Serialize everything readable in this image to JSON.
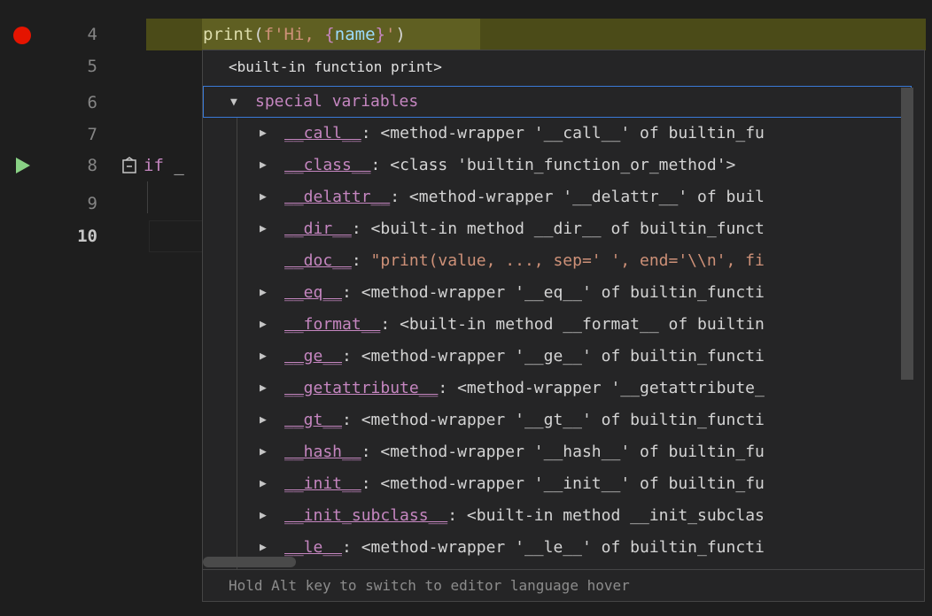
{
  "editor": {
    "lines": [
      {
        "num": "4",
        "breakpoint": true
      },
      {
        "num": "5"
      },
      {
        "num": "6"
      },
      {
        "num": "7"
      },
      {
        "num": "8",
        "debug_arrow": true
      },
      {
        "num": "9"
      },
      {
        "num": "10",
        "active": true
      }
    ],
    "line4": {
      "fn": "print",
      "paren_open": "(",
      "prefix": "f'Hi, ",
      "brace_open": "{",
      "var": "name",
      "brace_close": "}",
      "suffix": "'",
      "paren_close": ")"
    },
    "line8": {
      "keyword": "if",
      "rest": " _"
    }
  },
  "hover": {
    "header": "<built-in function print>",
    "root_label": "special variables",
    "items": [
      {
        "key": "__call__",
        "value": "<method-wrapper '__call__' of builtin_fu",
        "expandable": true
      },
      {
        "key": "__class__",
        "value": "<class 'builtin_function_or_method'>",
        "expandable": true
      },
      {
        "key": "__delattr__",
        "value": "<method-wrapper '__delattr__' of buil",
        "expandable": true
      },
      {
        "key": "__dir__",
        "value": "<built-in method __dir__ of builtin_funct",
        "expandable": true
      },
      {
        "key": "__doc__",
        "value": "\"print(value, ..., sep=' ', end='\\\\n', fi",
        "expandable": false,
        "string": true
      },
      {
        "key": "__eq__",
        "value": "<method-wrapper '__eq__' of builtin_functi",
        "expandable": true
      },
      {
        "key": "__format__",
        "value": "<built-in method __format__ of builtin",
        "expandable": true
      },
      {
        "key": "__ge__",
        "value": "<method-wrapper '__ge__' of builtin_functi",
        "expandable": true
      },
      {
        "key": "__getattribute__",
        "value": "<method-wrapper '__getattribute_",
        "expandable": true
      },
      {
        "key": "__gt__",
        "value": "<method-wrapper '__gt__' of builtin_functi",
        "expandable": true
      },
      {
        "key": "__hash__",
        "value": "<method-wrapper '__hash__' of builtin_fu",
        "expandable": true
      },
      {
        "key": "__init__",
        "value": "<method-wrapper '__init__' of builtin_fu",
        "expandable": true
      },
      {
        "key": "__init_subclass__",
        "value": "<built-in method __init_subclas",
        "expandable": true
      },
      {
        "key": "__le__",
        "value": "<method-wrapper '__le__' of builtin_functi",
        "expandable": true
      }
    ],
    "footer": "Hold Alt key to switch to editor language hover"
  },
  "colors": {
    "breakpoint": "#e51400",
    "debug_arrow": "#89d185",
    "highlight_line": "#4b4b18",
    "focus_border": "#3a7ad6"
  },
  "icons": {
    "twist_expanded": "▼",
    "twist_collapsed": "▶"
  }
}
